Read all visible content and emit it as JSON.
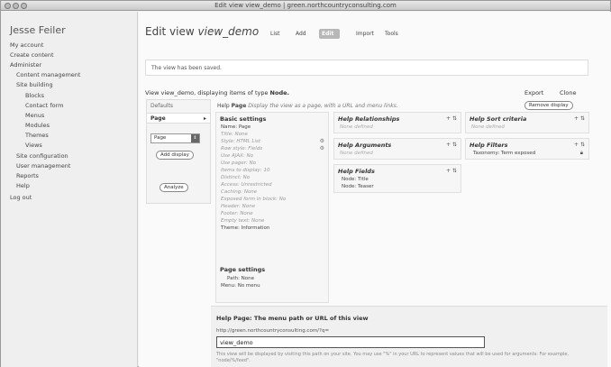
{
  "window": {
    "title": "Edit view view_demo | green.northcountryconsulting.com"
  },
  "sidebar": {
    "user_name": "Jesse Feiler",
    "items": [
      {
        "label": "My account"
      },
      {
        "label": "Create content"
      },
      {
        "label": "Administer"
      },
      {
        "label": "Content management"
      },
      {
        "label": "Site building"
      },
      {
        "label": "Blocks"
      },
      {
        "label": "Contact form"
      },
      {
        "label": "Menus"
      },
      {
        "label": "Modules"
      },
      {
        "label": "Themes"
      },
      {
        "label": "Views"
      },
      {
        "label": "Site configuration"
      },
      {
        "label": "User management"
      },
      {
        "label": "Reports"
      },
      {
        "label": "Help"
      },
      {
        "label": "Log out"
      }
    ]
  },
  "main": {
    "title_prefix": "Edit view",
    "title_view": "view_demo",
    "tabs": [
      {
        "label": "List"
      },
      {
        "label": "Add"
      },
      {
        "label": "Edit",
        "active": true
      },
      {
        "label": "Import"
      },
      {
        "label": "Tools"
      }
    ],
    "status_message": "The view has been saved.",
    "view_line_prefix": "View view_demo, displaying items of type",
    "view_line_type": "Node.",
    "export_label": "Export",
    "clone_label": "Clone"
  },
  "displays": {
    "defaults_label": "Defaults",
    "page_label": "Page",
    "page_arrow": "▸",
    "select_value": "Page",
    "add_display_label": "Add display",
    "analyze_label": "Analyze"
  },
  "help_line": {
    "help": "Help",
    "page": "Page",
    "description": "Display the view as a page, with a URL and menu links."
  },
  "remove_display_label": "Remove display",
  "basic_settings": {
    "title": "Basic settings",
    "rows": [
      {
        "text": "Name: Page",
        "dim": false
      },
      {
        "text": "Title: None",
        "dim": true
      },
      {
        "text": "Style: HTML List",
        "dim": true,
        "gear": true
      },
      {
        "text": "Row style: Fields",
        "dim": true,
        "gear": true
      },
      {
        "text": "Use AJAX: No",
        "dim": true
      },
      {
        "text": "Use pager: No",
        "dim": true
      },
      {
        "text": "Items to display: 10",
        "dim": true
      },
      {
        "text": "Distinct: No",
        "dim": true
      },
      {
        "text": "Access: Unrestricted",
        "dim": true
      },
      {
        "text": "Caching: None",
        "dim": true
      },
      {
        "text": "Exposed form in block: No",
        "dim": true
      },
      {
        "text": "Header: None",
        "dim": true
      },
      {
        "text": "Footer: None",
        "dim": true
      },
      {
        "text": "Empty text: None",
        "dim": true
      },
      {
        "text": "Theme: Information",
        "dim": false
      }
    ]
  },
  "page_settings": {
    "title": "Page settings",
    "rows": [
      {
        "text": "Path: None"
      },
      {
        "text": "Menu: No menu"
      }
    ]
  },
  "blocks": {
    "relationships": {
      "title": "Help Relationships",
      "icons": "+ ⇅",
      "none": "None defined"
    },
    "arguments": {
      "title": "Help Arguments",
      "icons": "+ ⇅",
      "none": "None defined"
    },
    "fields": {
      "title": "Help Fields",
      "icons": "+ ⇅",
      "items": [
        "Node: Title",
        "Node: Teaser"
      ]
    },
    "sort": {
      "title": "Help Sort criteria",
      "icons": "+ ⇅",
      "none": "None defined"
    },
    "filters": {
      "title": "Help Filters",
      "icons": "+ ⇅",
      "items": [
        "Taxonomy: Term exposed"
      ]
    }
  },
  "bottom": {
    "heading": "Help Page: The menu path or URL of this view",
    "url_prefix": "http://green.northcountryconsulting.com/?q=",
    "path_value": "view_demo",
    "note": "This view will be displayed by visiting this path on your site. You may use \"%\" in your URL to represent values that will be used for arguments: For example, \"node/%/feed\"."
  }
}
